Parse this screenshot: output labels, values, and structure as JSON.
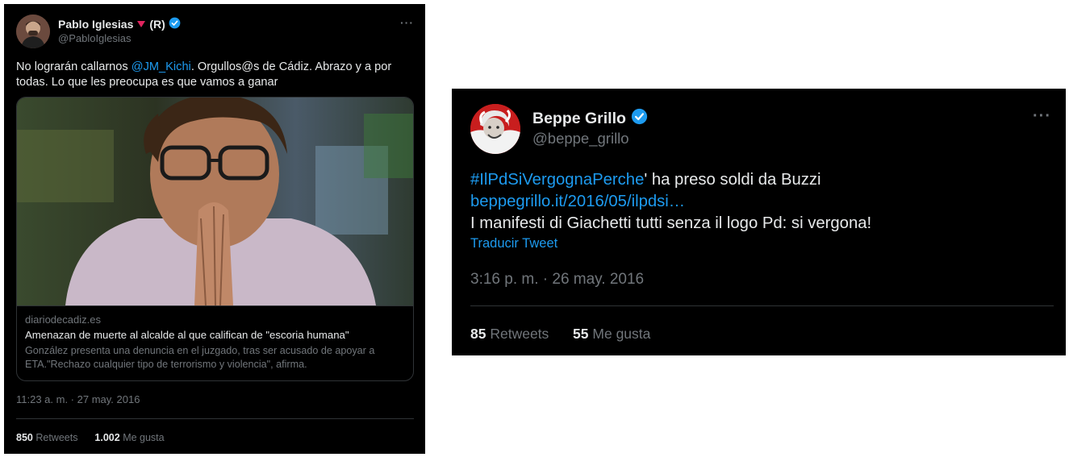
{
  "tweet1": {
    "name": "Pablo Iglesias",
    "name_suffix": "(R)",
    "handle": "@PabloIglesias",
    "text_before": "No lograrán callarnos ",
    "mention": "@JM_Kichi",
    "text_after": ". Orgullos@s de Cádiz. Abrazo y a por todas. Lo que les preocupa es que vamos a ganar",
    "card": {
      "domain": "diariodecadiz.es",
      "title": "Amenazan de muerte al alcalde al que califican de \"escoria humana\"",
      "description": "González presenta una denuncia en el juzgado, tras ser acusado de apoyar a ETA.\"Rechazo cualquier tipo de terrorismo y violencia\", afirma."
    },
    "timestamp": "11:23 a. m. · 27 may. 2016",
    "retweets_count": "850",
    "retweets_label": "Retweets",
    "likes_count": "1.002",
    "likes_label": "Me gusta"
  },
  "tweet2": {
    "name": "Beppe Grillo",
    "handle": "@beppe_grillo",
    "hashtag": "#IlPdSiVergognaPerche",
    "text_line1_rest": "' ha preso soldi da Buzzi",
    "link": "beppegrillo.it/2016/05/ilpdsi…",
    "text_line3": "I manifesti di Giachetti tutti senza il logo Pd: si vergona!",
    "translate_label": "Traducir Tweet",
    "timestamp": "3:16 p. m. · 26 may. 2016",
    "retweets_count": "85",
    "retweets_label": "Retweets",
    "likes_count": "55",
    "likes_label": "Me gusta"
  },
  "colors": {
    "background": "#000000",
    "text": "#e7e9ea",
    "secondary": "#71767b",
    "accent": "#1d9bf0",
    "divider": "#2f3336"
  },
  "icons": [
    "verified-badge-icon",
    "more-options-icon",
    "red-triangle-icon"
  ]
}
